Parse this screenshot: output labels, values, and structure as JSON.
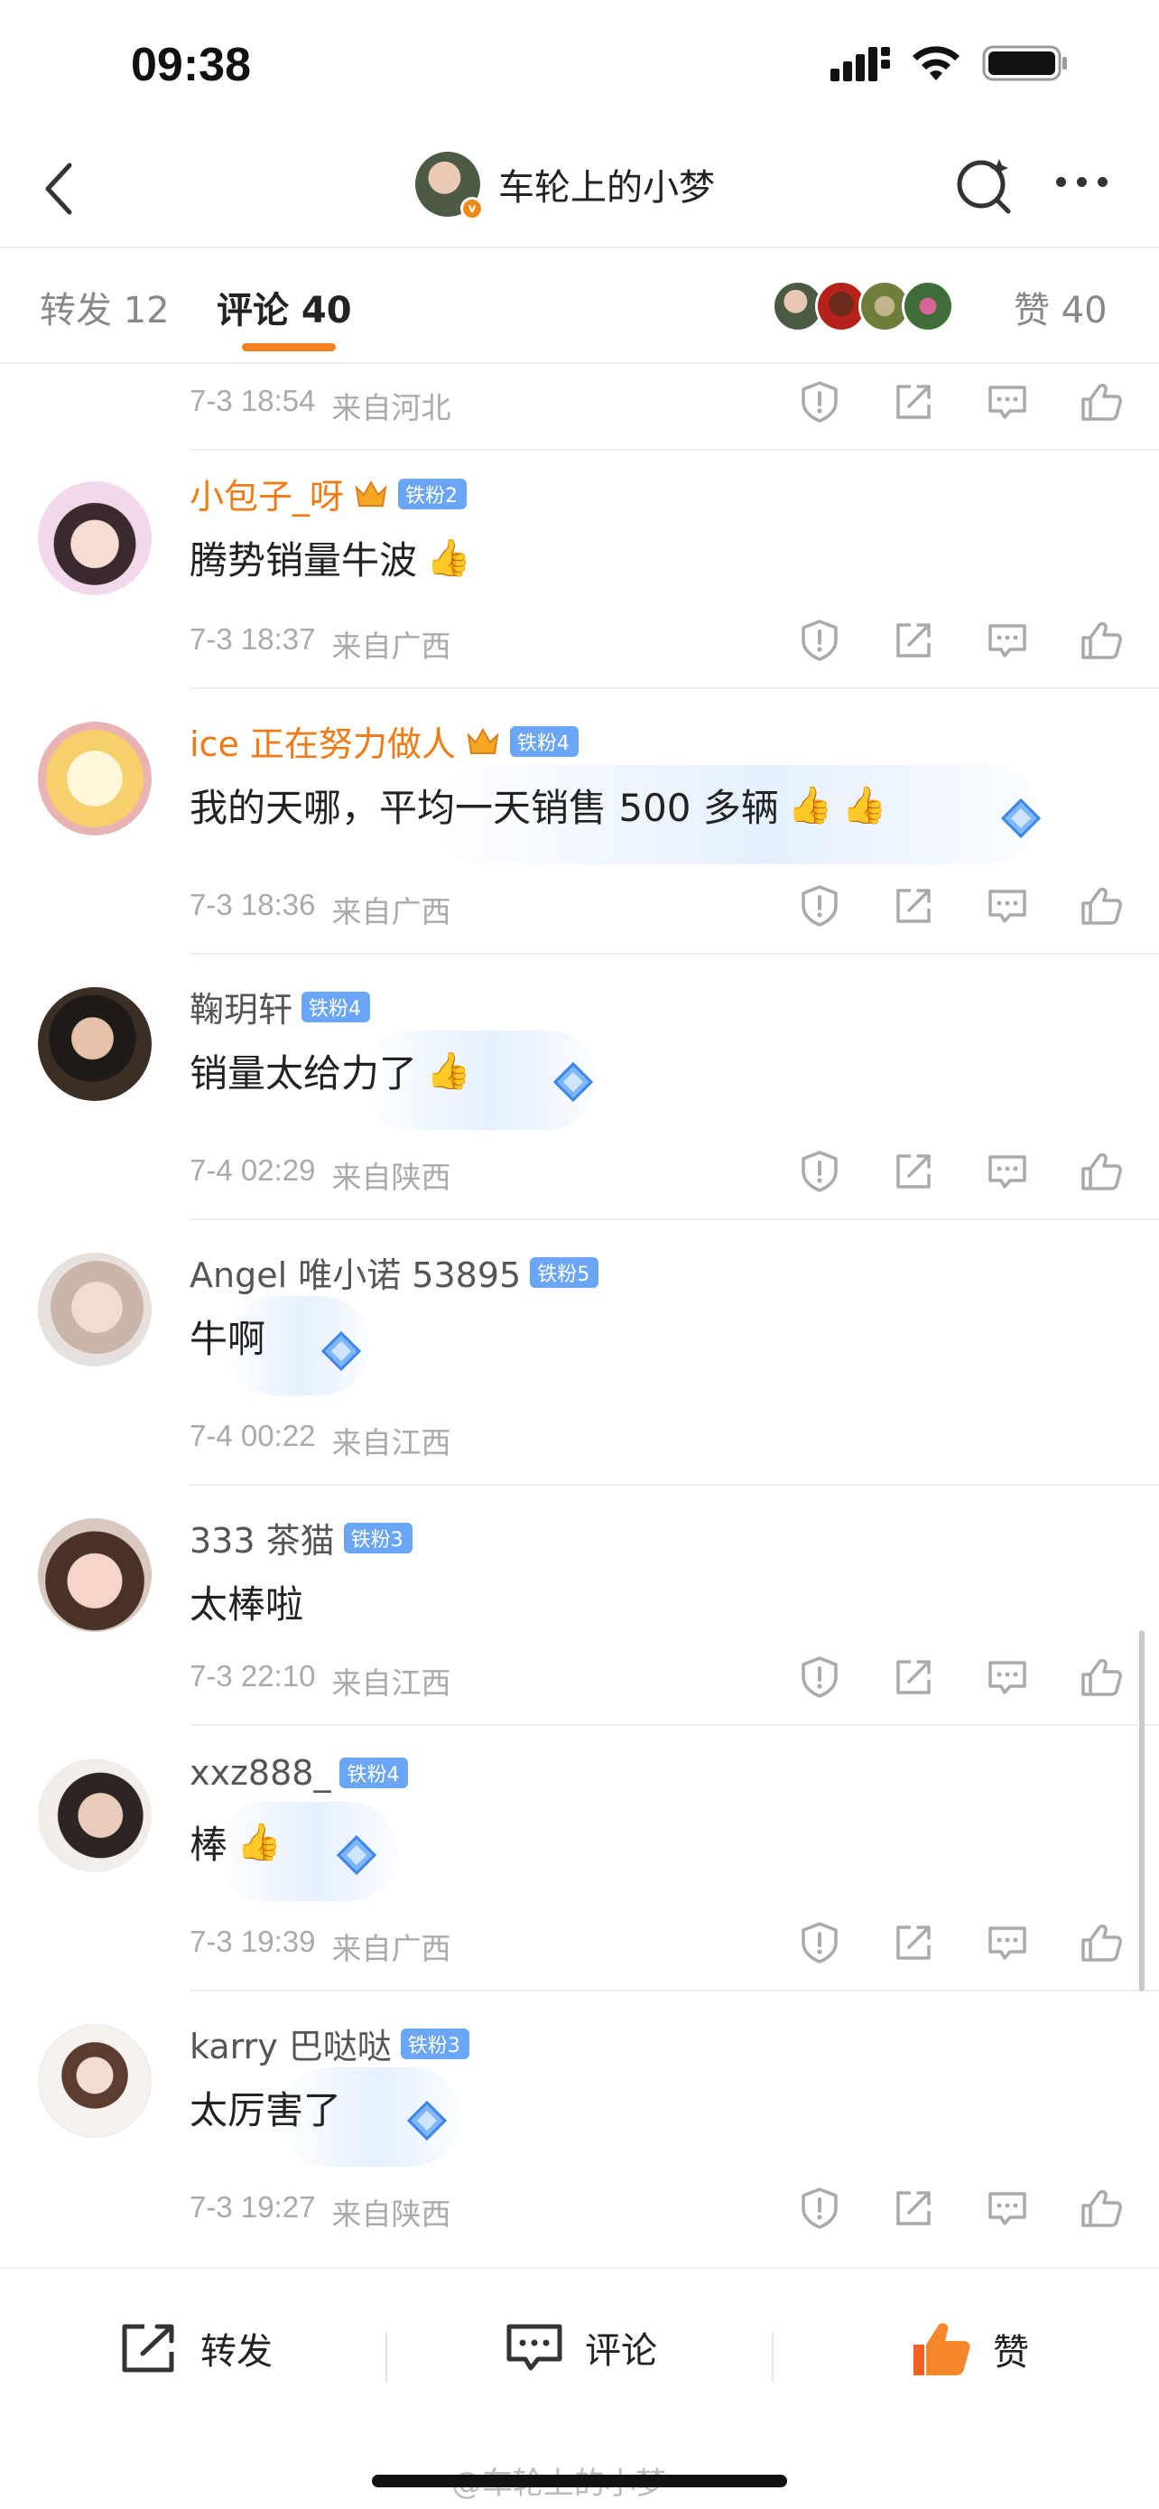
{
  "status": {
    "time": "09:38"
  },
  "nav": {
    "title": "车轮上的小梦"
  },
  "tabs": {
    "repost": "转发 12",
    "comment": "评论 40",
    "like": "赞 40"
  },
  "top_meta": {
    "time": "7-3 18:54",
    "location": "来自河北"
  },
  "comments": [
    {
      "username": "小包子_呀",
      "badge": "铁粉2",
      "text": "腾势销量牛波",
      "time": "7-3 18:37",
      "location": "来自广西"
    },
    {
      "username": "ice 正在努力做人",
      "badge": "铁粉4",
      "text": "我的天哪，平均一天销售 500 多辆",
      "time": "7-3 18:36",
      "location": "来自广西"
    },
    {
      "username": "鞠玥轩",
      "badge": "铁粉4",
      "text": "销量太给力了",
      "time": "7-4 02:29",
      "location": "来自陕西"
    },
    {
      "username": "Angel 唯小诺 53895",
      "badge": "铁粉5",
      "text": "牛啊",
      "time": "7-4 00:22",
      "location": "来自江西"
    },
    {
      "username": "333 茶猫",
      "badge": "铁粉3",
      "text": "太棒啦",
      "time": "7-3 22:10",
      "location": "来自江西"
    },
    {
      "username": "xxz888_",
      "badge": "铁粉4",
      "text": "棒",
      "time": "7-3 19:39",
      "location": "来自广西"
    },
    {
      "username": "karry 巴哒哒",
      "badge": "铁粉3",
      "text": "太厉害了",
      "time": "7-3 19:27",
      "location": "来自陕西"
    }
  ],
  "bottom": {
    "repost": "转发",
    "comment": "评论",
    "like": "赞"
  },
  "watermark": "@车轮上的小梦",
  "colors": {
    "accent": "#f5821f",
    "username_vip": "#f07a14",
    "badge": "#6aa6f5"
  },
  "icons": [
    "back-icon",
    "search-icon",
    "more-icon",
    "report-icon",
    "share-icon",
    "comment-icon",
    "like-icon"
  ]
}
